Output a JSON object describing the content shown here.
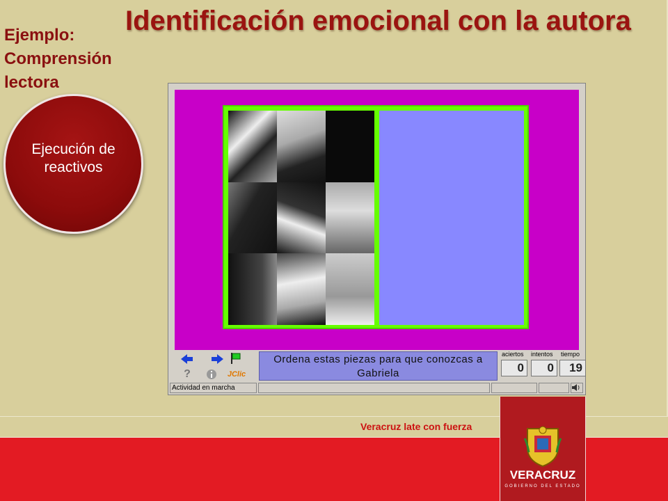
{
  "slide": {
    "title": "Identificación emocional con la autora",
    "subtitle_line1": "Ejemplo:",
    "subtitle_line2": "Comprensión",
    "subtitle_line3": "lectora",
    "circle_label": "Ejecución de reactivos"
  },
  "jclic": {
    "message": "Ordena estas piezas para que conozcas a Gabriela",
    "counters": {
      "aciertos_label": "aciertos",
      "aciertos_value": "0",
      "intentos_label": "intentos",
      "intentos_value": "0",
      "tiempo_label": "tiempo",
      "tiempo_value": "19"
    },
    "status_text": "Actividad en marcha",
    "brand": "JClic",
    "icons": [
      "arrow-left-icon",
      "arrow-right-icon",
      "flag-icon",
      "help-icon",
      "info-icon",
      "sound-icon"
    ]
  },
  "footer": {
    "slogan": "Veracruz late con fuerza",
    "logo_text": "VERACRUZ",
    "logo_sub": "GOBIERNO DEL ESTADO"
  },
  "colors": {
    "background": "#d8cf9c",
    "title": "#9a1410",
    "board": "#c800c8",
    "frame": "#66ff00",
    "target": "#8888ff",
    "footer_red": "#e31b23"
  }
}
